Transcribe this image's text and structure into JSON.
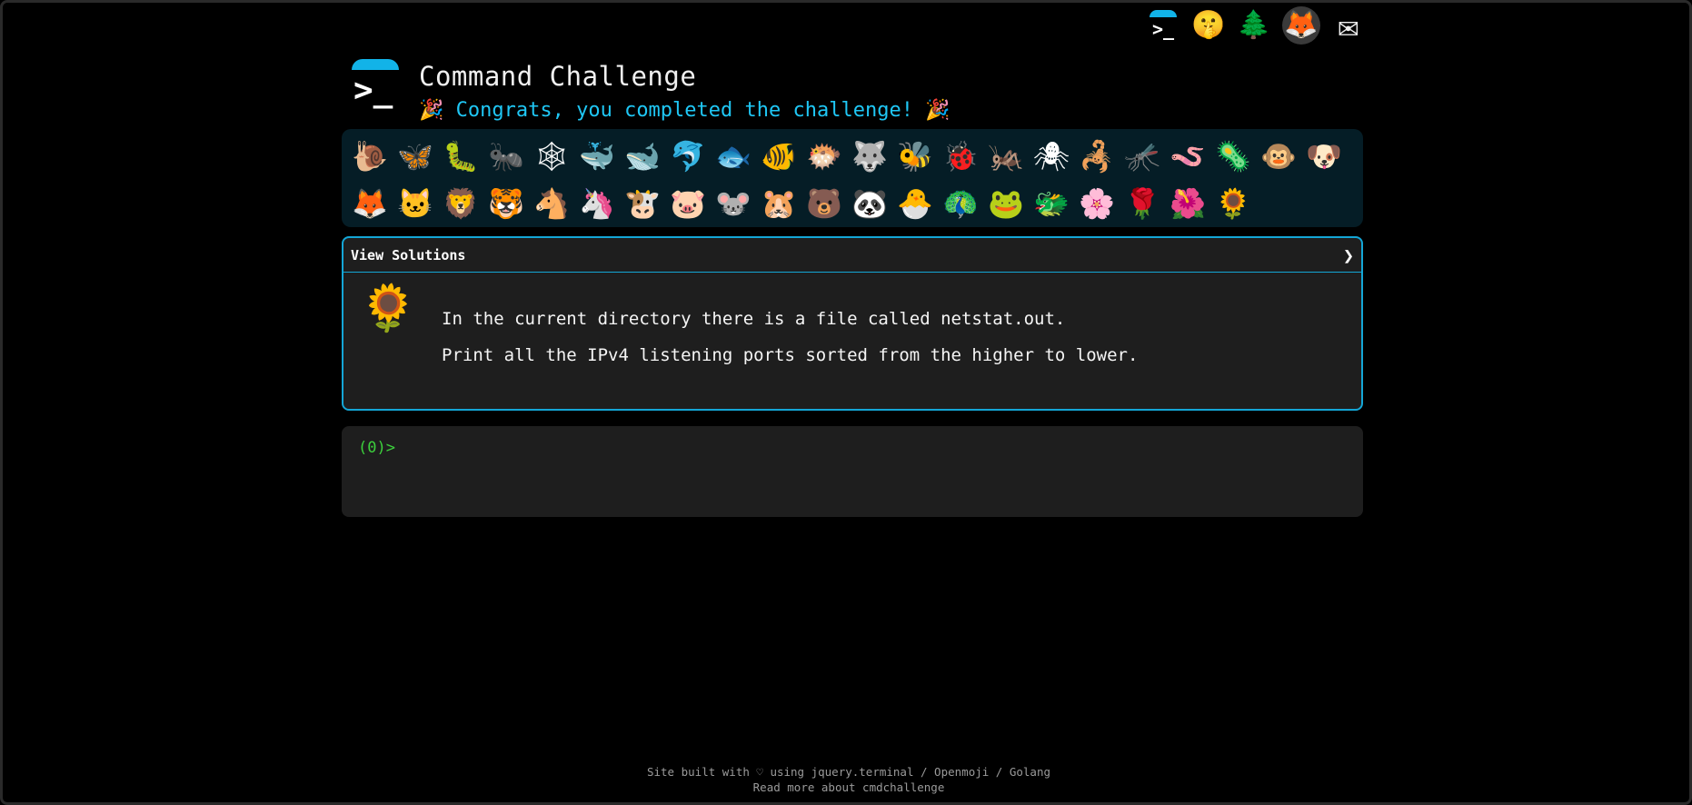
{
  "nav": {
    "home_icon": "terminal-logo",
    "items": [
      {
        "name": "shush-face-icon",
        "glyph": "🤫"
      },
      {
        "name": "tree-icon",
        "glyph": "🌲"
      },
      {
        "name": "gitlab-icon",
        "glyph": "🦊"
      },
      {
        "name": "mail-icon",
        "glyph": "✉"
      }
    ]
  },
  "header": {
    "title": "Command Challenge",
    "congrats": "🎉 Congrats, you completed the challenge! 🎉",
    "accent_color": "#12b3e8"
  },
  "collection": {
    "row1": [
      "🐌",
      "🦋",
      "🐛",
      "🐜",
      "🕸",
      "🐳",
      "🐋",
      "🐬",
      "🐟",
      "🐠",
      "🐡",
      "🐺",
      "🐝",
      "🐞",
      "🦗",
      "🕷",
      "🦂",
      "🦟",
      "🪱",
      "🦠",
      "🐵",
      "🐶"
    ],
    "row2": [
      "🦊",
      "🐱",
      "🦁",
      "🐯",
      "🐴",
      "🦄",
      "🐮",
      "🐷",
      "🐭",
      "🐹",
      "🐻",
      "🐼",
      "🐣",
      "🦚",
      "🐸",
      "🐲",
      "🌸",
      "🌹",
      "🌺",
      "🌻"
    ]
  },
  "panel": {
    "head_label": "View Solutions",
    "chevron": "❯",
    "icon": "🌻",
    "line1": "In the current directory there is a file called netstat.out.",
    "line2": "Print all the IPv4 listening ports sorted from the higher to lower."
  },
  "terminal": {
    "prompt": "(0)>"
  },
  "footer": {
    "line1": "Site built with ♡ using jquery.terminal / Openmoji / Golang",
    "line2": "Read more about cmdchallenge"
  }
}
